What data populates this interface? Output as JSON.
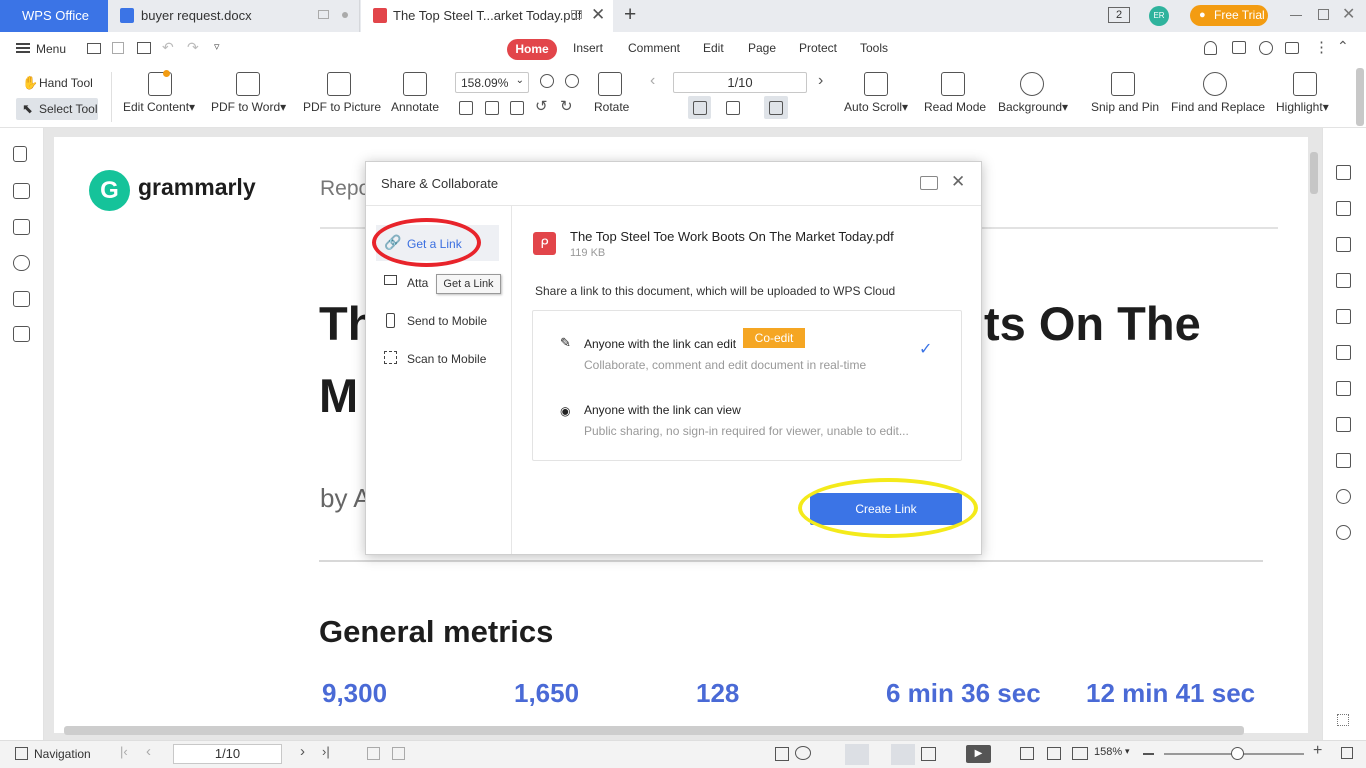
{
  "titlebar": {
    "app_tab": "WPS Office",
    "doc_tab_1": "buyer request.docx",
    "doc_tab_2": "The Top Steel T...arket Today.pdf",
    "badge_count": "2",
    "avatar_initials": "ER",
    "free_trial": "Free Trial"
  },
  "menubar": {
    "menu_label": "Menu",
    "tabs": [
      "Home",
      "Insert",
      "Comment",
      "Edit",
      "Page",
      "Protect",
      "Tools"
    ]
  },
  "toolbar": {
    "hand_tool": "Hand Tool",
    "select_tool": "Select Tool",
    "edit_content": "Edit Content",
    "pdf_to_word": "PDF to Word",
    "pdf_to_picture": "PDF to Picture",
    "annotate": "Annotate",
    "zoom": "158.09%",
    "rotate": "Rotate",
    "page_input": "1/10",
    "auto_scroll": "Auto Scroll",
    "read_mode": "Read Mode",
    "background": "Background",
    "snip_and_pin": "Snip and Pin",
    "find_and_replace": "Find and Replace",
    "highlight": "Highlight"
  },
  "document": {
    "logo_text": "grammarly",
    "report_partial": "Repo",
    "title_line1_left": "Th",
    "title_line1_right": "ts On The",
    "title_line2": "M",
    "byline": "by A",
    "section_heading": "General metrics",
    "metrics": [
      "9,300",
      "1,650",
      "128",
      "6 min 36 sec",
      "12 min 41 sec"
    ]
  },
  "dialog": {
    "title": "Share & Collaborate",
    "nav": {
      "get_link": "Get a Link",
      "attach_partial": "Atta",
      "tooltip": "Get a Link",
      "send_to_mobile": "Send to Mobile",
      "scan_to_mobile": "Scan to Mobile"
    },
    "file_name": "The Top Steel Toe Work Boots On The Market Today.pdf",
    "file_size": "119 KB",
    "share_desc": "Share a link to this document, which will be uploaded to WPS Cloud",
    "option_edit": {
      "title": "Anyone with the link can edit",
      "badge": "Co-edit",
      "desc": "Collaborate, comment and edit document in real-time"
    },
    "option_view": {
      "title": "Anyone with the link can view",
      "desc": "Public sharing, no sign-in required for viewer, unable to edit..."
    },
    "create_link": "Create Link"
  },
  "statusbar": {
    "navigation": "Navigation",
    "page": "1/10",
    "zoom": "158%"
  },
  "colors": {
    "accent_blue": "#3b74e6",
    "home_red": "#e2454a",
    "free_trial_orange": "#f39c12",
    "coedit_badge": "#f5a623",
    "grammarly_green": "#15c39a",
    "metric_blue": "#4a6ad6",
    "annotation_red": "#e8242b",
    "annotation_yellow": "#f4ea1a"
  }
}
